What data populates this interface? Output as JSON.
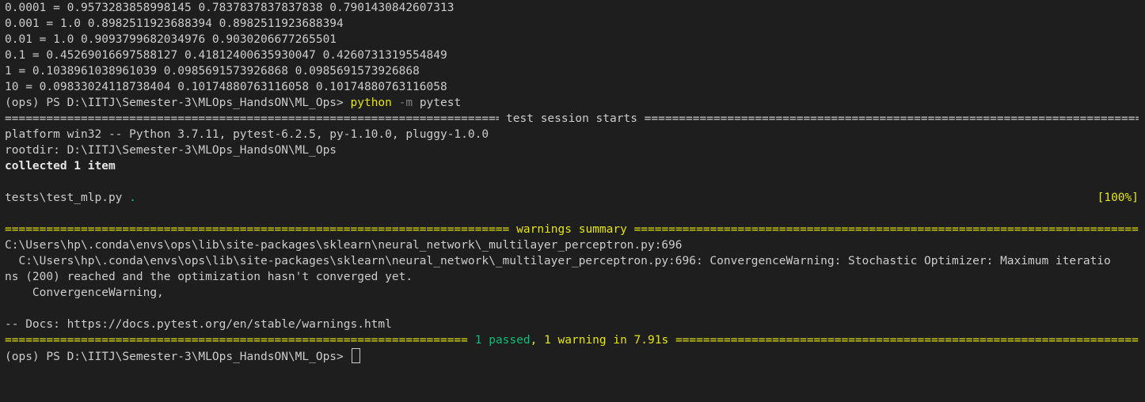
{
  "results": [
    {
      "key": "0.0001 =",
      "vals": " 0.9573283858998145 0.7837837837837838 0.7901430842607313"
    },
    {
      "key": "0.001 =",
      "vals": " 1.0 0.8982511923688394 0.8982511923688394"
    },
    {
      "key": "0.01 =",
      "vals": " 1.0 0.9093799682034976 0.9030206677265501"
    },
    {
      "key": "0.1 =",
      "vals": " 0.45269016697588127 0.41812400635930047 0.4260731319554849"
    },
    {
      "key": "1 =",
      "vals": " 0.1038961038961039 0.0985691573926868 0.0985691573926868"
    },
    {
      "key": "10 =",
      "vals": " 0.09833024118738404 0.10174880763116058 0.10174880763116058"
    }
  ],
  "prompt1": {
    "text": "(ops) PS D:\\IITJ\\Semester-3\\MLOps_HandsON\\ML_Ops> ",
    "cmd": "python",
    "flag": "-m",
    "args": " pytest"
  },
  "session": {
    "title": " test session starts ",
    "platform": "platform win32 -- Python 3.7.11, pytest-6.2.5, py-1.10.0, pluggy-1.0.0",
    "rootdir": "rootdir: D:\\IITJ\\Semester-3\\MLOps_HandsON\\ML_Ops",
    "collected": "collected 1 item",
    "test_file": "tests\\test_mlp.py ",
    "test_dot": ".",
    "percent": "[100%]"
  },
  "warnings": {
    "title": " warnings summary ",
    "location": "C:\\Users\\hp\\.conda\\envs\\ops\\lib\\site-packages\\sklearn\\neural_network\\_multilayer_perceptron.py:696",
    "message_line1": "  C:\\Users\\hp\\.conda\\envs\\ops\\lib\\site-packages\\sklearn\\neural_network\\_multilayer_perceptron.py:696: ConvergenceWarning: Stochastic Optimizer: Maximum iteratio",
    "message_line2": "ns (200) reached and the optimization hasn't converged yet.",
    "message_line3": "    ConvergenceWarning,",
    "docs": "-- Docs: https://docs.pytest.org/en/stable/warnings.html"
  },
  "summary": {
    "passed": " 1 passed",
    "comma": ",",
    "warning": " 1 warning in 7.91s "
  },
  "prompt2": {
    "text": "(ops) PS D:\\IITJ\\Semester-3\\MLOps_HandsON\\ML_Ops> "
  },
  "colors": {
    "background": "#1e1e1e",
    "foreground": "#cccccc",
    "yellow": "#e5e510",
    "green": "#0dbc79",
    "grey": "#7f7f7f"
  }
}
